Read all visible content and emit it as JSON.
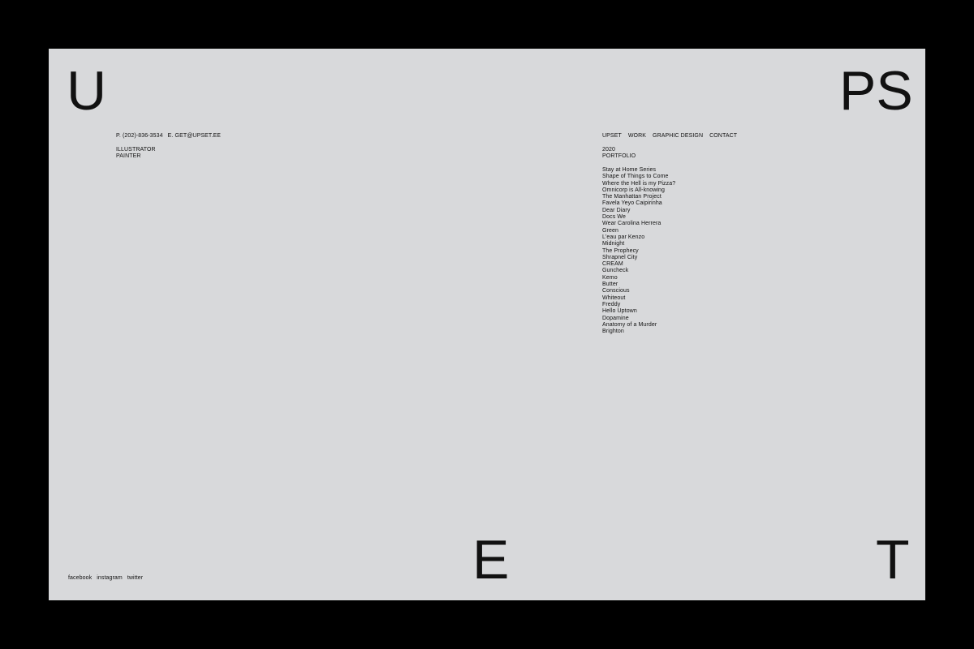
{
  "corner_letters": {
    "top_left": "U",
    "top_right": "PS",
    "bottom_middle": "E",
    "bottom_right": "T"
  },
  "contact": {
    "phone": "P.  (202)-836-3534",
    "email": "E.  GET@UPSET.EE"
  },
  "roles": [
    "ILLUSTRATOR",
    "PAINTER"
  ],
  "nav": {
    "items": [
      "UPSET",
      "WORK",
      "GRAPHIC DESIGN",
      "CONTACT"
    ]
  },
  "portfolio": {
    "year": "2020",
    "label": "PORTFOLIO",
    "items": [
      "Stay at Home Series",
      "Shape of Things to Come",
      "Where the Hell is my Pizza?",
      "Omnicorp is All-knowing",
      "The Manhattan Project",
      "Favela Yeyo Caipirinha",
      "Dear Diary",
      "Docs We",
      "Wear Carolina Herrera",
      "Green",
      "L'eau par Kenzo",
      "Midnight",
      "The Prophecy",
      "Shrapnel City",
      "CREAM",
      "Guncheck",
      "Kemo",
      "Butter",
      "Conscious",
      "Whiteout",
      "Freddy",
      "Hello Uptown",
      "Dopamine",
      "Anatomy of a Murder",
      "Brighton"
    ]
  },
  "social": {
    "items": [
      "facebook",
      "instagram",
      "twitter"
    ]
  },
  "colors": {
    "outer_background": "#000000",
    "page_background": "#d8d9db",
    "text": "#111111"
  }
}
